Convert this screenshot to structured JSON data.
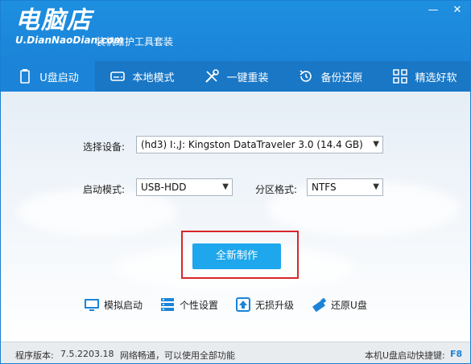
{
  "header": {
    "logo_title": "电脑店",
    "logo_url": "U.DianNaoDian.com",
    "logo_subtitle": "装机维护工具套装",
    "minimize_glyph": "—",
    "close_glyph": "✕"
  },
  "nav": {
    "items": [
      {
        "label": "U盘启动",
        "icon": "usb-drive-icon",
        "active": true
      },
      {
        "label": "本地模式",
        "icon": "hard-drive-icon",
        "active": false
      },
      {
        "label": "一键重装",
        "icon": "tools-icon",
        "active": false
      },
      {
        "label": "备份还原",
        "icon": "restore-icon",
        "active": false
      },
      {
        "label": "精选好软",
        "icon": "apps-grid-icon",
        "active": false
      }
    ]
  },
  "form": {
    "device_label": "选择设备:",
    "device_value": "(hd3) I:,J: Kingston DataTraveler 3.0 (14.4 GB)",
    "boot_mode_label": "启动模式:",
    "boot_mode_value": "USB-HDD",
    "partition_label": "分区格式:",
    "partition_value": "NTFS"
  },
  "actions": {
    "make_label": "全新制作"
  },
  "tools": [
    {
      "label": "模拟启动",
      "icon": "simulate-boot-icon"
    },
    {
      "label": "个性设置",
      "icon": "settings-icon"
    },
    {
      "label": "无损升级",
      "icon": "upgrade-icon"
    },
    {
      "label": "还原U盘",
      "icon": "restore-usb-icon"
    }
  ],
  "status": {
    "version_label": "程序版本:",
    "version": "7.5.2203.18",
    "network": "网络畅通，可以使用全部功能",
    "shortcut_label": "本机U盘启动快捷键:",
    "shortcut_key": "F8"
  },
  "colors": {
    "header_blue": "#1b84d8",
    "nav_blue": "#1977c6",
    "button_blue": "#1ea7ec",
    "highlight_red": "#d9262b"
  }
}
